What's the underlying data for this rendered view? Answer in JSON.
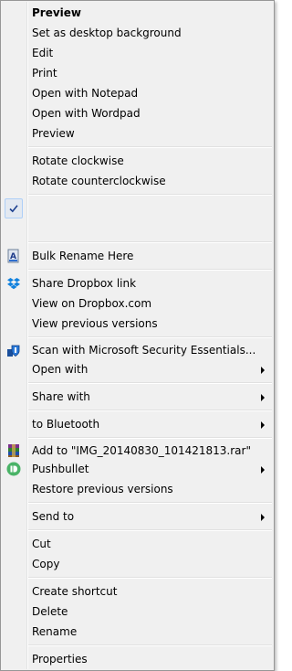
{
  "menu": {
    "items": [
      {
        "label": "Preview"
      },
      {
        "label": "Set as desktop background"
      },
      {
        "label": "Edit"
      },
      {
        "label": "Print"
      },
      {
        "label": "Open with Notepad"
      },
      {
        "label": "Open with Wordpad"
      },
      {
        "label": "Preview"
      },
      {
        "label": "Rotate clockwise"
      },
      {
        "label": "Rotate counterclockwise"
      },
      {
        "label": ""
      },
      {
        "label": "Bulk Rename Here"
      },
      {
        "label": "Share Dropbox link"
      },
      {
        "label": "View on Dropbox.com"
      },
      {
        "label": "View previous versions"
      },
      {
        "label": "Scan with Microsoft Security Essentials..."
      },
      {
        "label": "Open with"
      },
      {
        "label": "Share with"
      },
      {
        "label": "to Bluetooth"
      },
      {
        "label": "Add to \"IMG_20140830_101421813.rar\""
      },
      {
        "label": "Pushbullet"
      },
      {
        "label": "Restore previous versions"
      },
      {
        "label": "Send to"
      },
      {
        "label": "Cut"
      },
      {
        "label": "Copy"
      },
      {
        "label": "Create shortcut"
      },
      {
        "label": "Delete"
      },
      {
        "label": "Rename"
      },
      {
        "label": "Properties"
      }
    ]
  },
  "icons": {
    "checkmark": "checkmark-icon",
    "bulk_rename": "bulk-rename-icon",
    "dropbox": "dropbox-icon",
    "security_essentials": "security-essentials-icon",
    "winrar": "winrar-icon",
    "pushbullet": "pushbullet-icon"
  },
  "colors": {
    "menu_bg": "#f0f0f0",
    "border": "#979797",
    "separator": "#e0e0e0",
    "check_highlight": "#e3e9f1",
    "dropbox_blue": "#1081de",
    "pushbullet_green": "#4ab367"
  }
}
